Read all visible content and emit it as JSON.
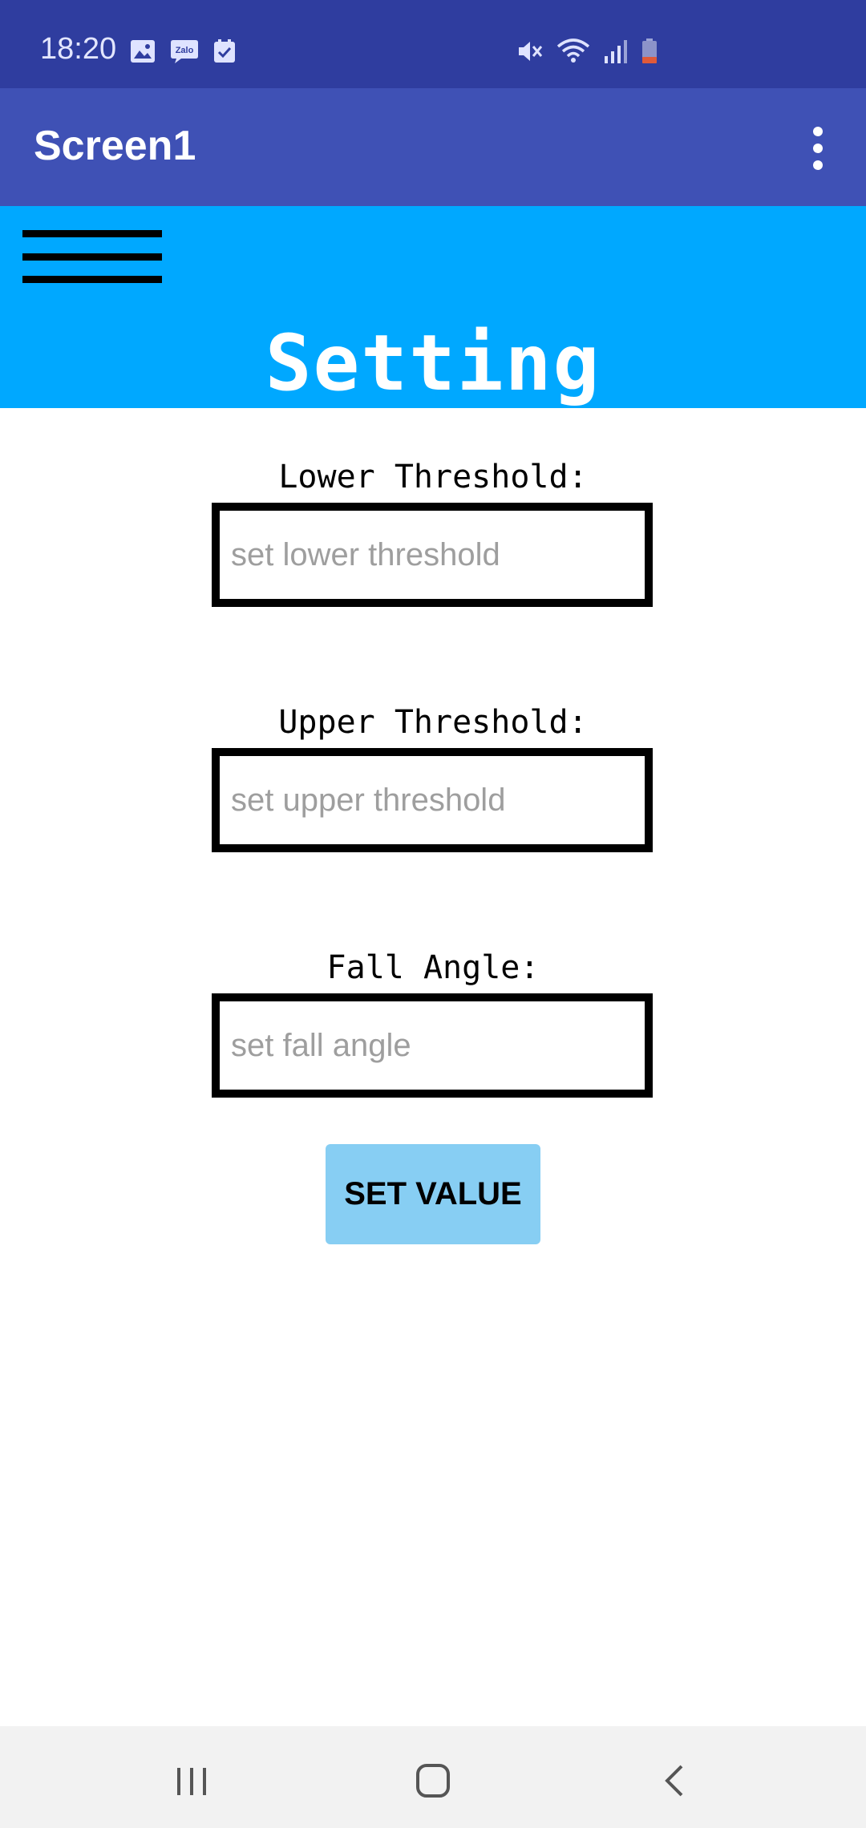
{
  "status_bar": {
    "time": "18:20",
    "left_icons": [
      "gallery-icon",
      "zalo-icon",
      "checkbox-icon"
    ],
    "right_icons": [
      "mute-icon",
      "wifi-icon",
      "signal-icon",
      "battery-icon"
    ],
    "battery_color": "#e05a3a"
  },
  "app_bar": {
    "title": "Screen1",
    "menu_icon": "more-vert-icon"
  },
  "header": {
    "menu_icon": "hamburger-icon",
    "title": "Setting"
  },
  "form": {
    "lower": {
      "label": "Lower Threshold:",
      "placeholder": "set lower threshold",
      "value": ""
    },
    "upper": {
      "label": "Upper Threshold:",
      "placeholder": "set upper threshold",
      "value": ""
    },
    "angle": {
      "label": "Fall Angle:",
      "placeholder": "set fall angle",
      "value": ""
    },
    "submit_label": "SET VALUE"
  },
  "nav_bar": {
    "buttons": [
      "recents-icon",
      "home-icon",
      "back-icon"
    ]
  },
  "colors": {
    "status_bar": "#2f3d9f",
    "app_bar": "#3f51b5",
    "header": "#00a8ff",
    "button": "#87cef3"
  }
}
